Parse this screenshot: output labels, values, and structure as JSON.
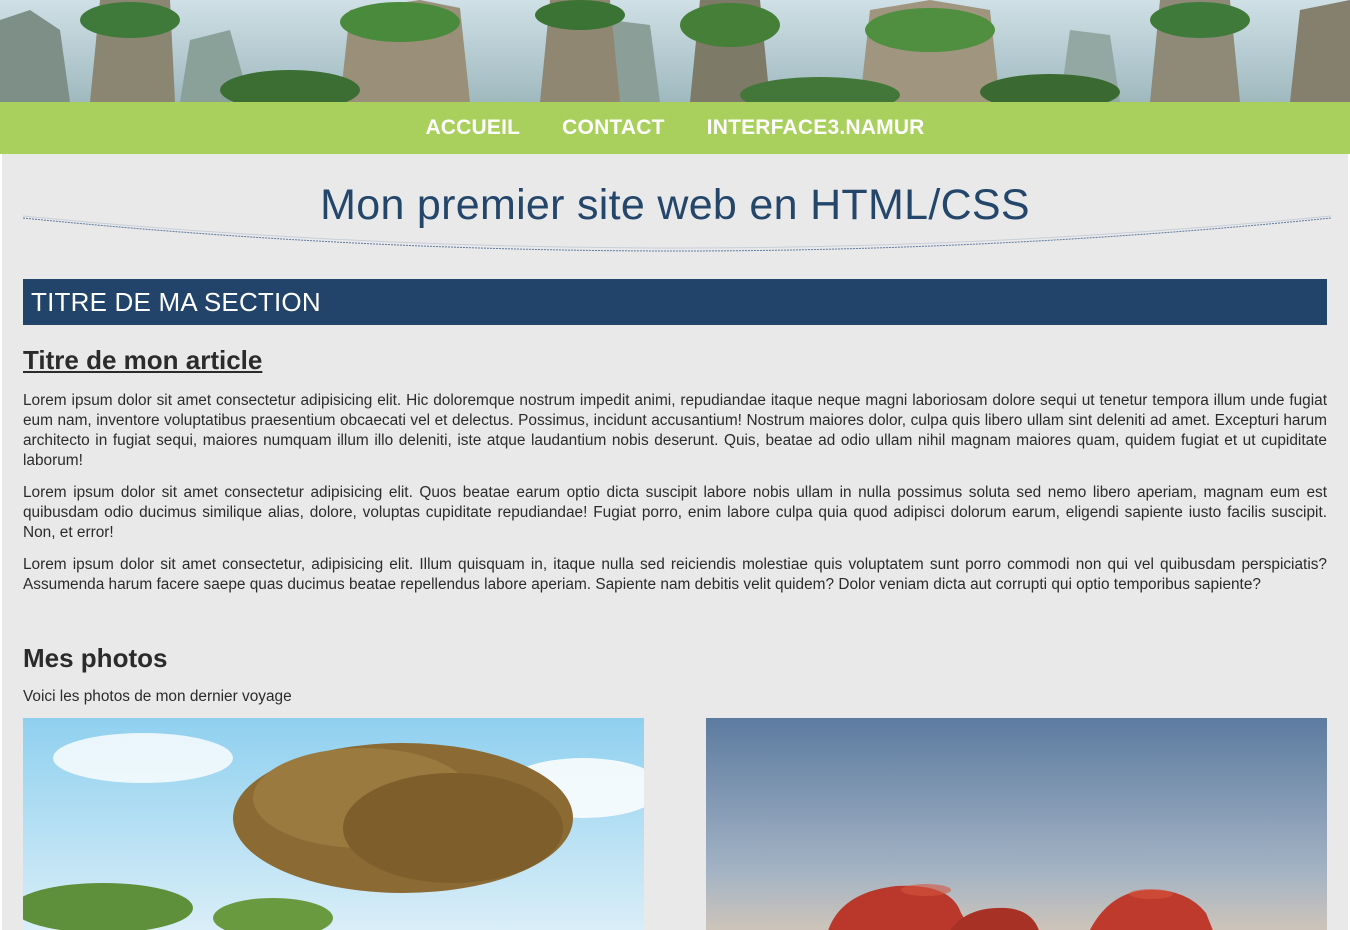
{
  "banner": {
    "alt": "mountain-pillars-landscape"
  },
  "nav": {
    "items": [
      {
        "label": "ACCUEIL"
      },
      {
        "label": "CONTACT"
      },
      {
        "label": "INTERFACE3.NAMUR"
      }
    ]
  },
  "header": {
    "title": "Mon premier site web en HTML/CSS"
  },
  "section": {
    "title": "TITRE DE MA SECTION",
    "article": {
      "title": "Titre de mon article",
      "paragraphs": [
        "Lorem ipsum dolor sit amet consectetur adipisicing elit. Hic doloremque nostrum impedit animi, repudiandae itaque neque magni laboriosam dolore sequi ut tenetur tempora illum unde fugiat eum nam, inventore voluptatibus praesentium obcaecati vel et delectus. Possimus, incidunt accusantium! Nostrum maiores dolor, culpa quis libero ullam sint deleniti ad amet. Excepturi harum architecto in fugiat sequi, maiores numquam illum illo deleniti, iste atque laudantium nobis deserunt. Quis, beatae ad odio ullam nihil magnam maiores quam, quidem fugiat et ut cupiditate laborum!",
        "Lorem ipsum dolor sit amet consectetur adipisicing elit. Quos beatae earum optio dicta suscipit labore nobis ullam in nulla possimus soluta sed nemo libero aperiam, magnam eum est quibusdam odio ducimus similique alias, dolore, voluptas cupiditate repudiandae! Fugiat porro, enim labore culpa quia quod adipisci dolorum earum, eligendi sapiente iusto facilis suscipit. Non, et error!",
        "Lorem ipsum dolor sit amet consectetur, adipisicing elit. Illum quisquam in, itaque nulla sed reiciendis molestiae quis voluptatem sunt porro commodi non qui vel quibusdam perspiciatis? Assumenda harum facere saepe quas ducimus beatae repellendus labore aperiam. Sapiente nam debitis velit quidem? Dolor veniam dicta aut corrupti qui optio temporibus sapiente?"
      ]
    }
  },
  "photos": {
    "title": "Mes photos",
    "subtitle": "Voici les photos de mon dernier voyage"
  },
  "colors": {
    "nav_bg": "#a9d05d",
    "section_bg": "#22446a",
    "title_color": "#25466b",
    "page_bg": "#e9e9e9"
  }
}
